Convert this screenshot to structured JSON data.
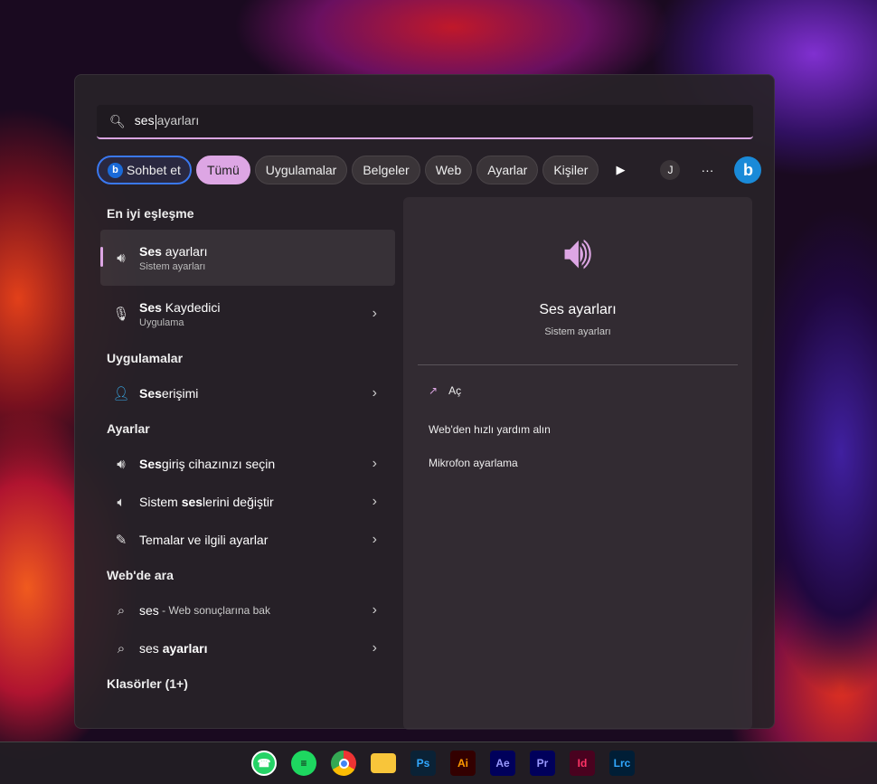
{
  "search": {
    "typed": "ses",
    "suggestion": "ayarları"
  },
  "chips": {
    "chat": "Sohbet et",
    "all": "Tümü",
    "apps": "Uygulamalar",
    "docs": "Belgeler",
    "web": "Web",
    "settings": "Ayarlar",
    "people": "Kişiler",
    "avatar": "J",
    "more": "···"
  },
  "left": {
    "best_header": "En iyi eşleşme",
    "best": {
      "bold": "Ses",
      "rest": " ayarları",
      "sub": "Sistem ayarları"
    },
    "recorder": {
      "bold": "Ses",
      "rest": " Kaydedici",
      "sub": "Uygulama"
    },
    "apps_header": "Uygulamalar",
    "access": {
      "bold": "Ses",
      "rest": " erişimi"
    },
    "settings_header": "Ayarlar",
    "s1": {
      "bold": "Ses",
      "rest": " giriş cihazınızı seçin"
    },
    "s2": {
      "pre": "Sistem ",
      "bold": "ses",
      "rest": "lerini değiştir"
    },
    "s3": {
      "text": "Temalar ve ilgili ayarlar"
    },
    "web_header": "Web'de ara",
    "w1": {
      "text": "ses",
      "rest": " - Web sonuçlarına bak"
    },
    "w2": {
      "text": "ses ",
      "bold": "ayarları"
    },
    "folders_header": "Klasörler (1+)"
  },
  "right": {
    "title": "Ses ayarları",
    "subtitle": "Sistem ayarları",
    "actions": [
      "Aç",
      "Web'den hızlı yardım alın",
      "Mikrofon ayarlama"
    ]
  },
  "taskbar": {
    "apps": [
      "Ps",
      "Ai",
      "Ae",
      "Pr",
      "Id",
      "Lrc"
    ]
  }
}
